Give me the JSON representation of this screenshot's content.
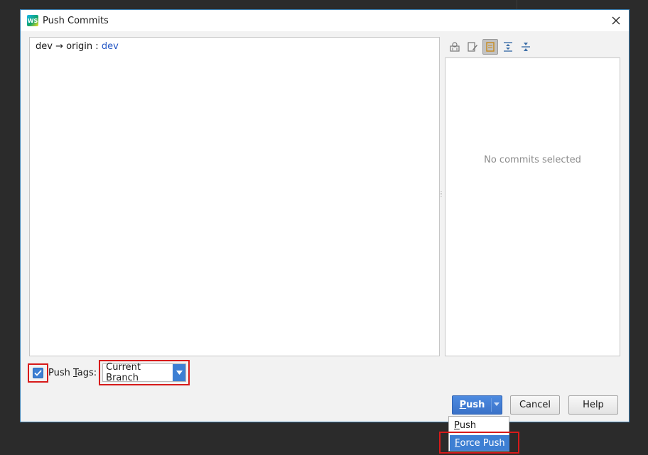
{
  "window": {
    "title": "Push Commits",
    "logo_text": "WS",
    "icon": "webstorm-logo-icon"
  },
  "left_panel": {
    "branch": {
      "source": "dev",
      "arrow": "→",
      "remote": "origin",
      "separator": ":",
      "target": "dev"
    }
  },
  "right_panel": {
    "toolbar_icons": [
      "author-icon",
      "edit-icon",
      "show-details-icon",
      "expand-all-icon",
      "collapse-all-icon"
    ],
    "empty_message": "No commits selected"
  },
  "push_tags": {
    "checked": true,
    "label_prefix": "Push ",
    "label_mnemonic": "T",
    "label_suffix": "ags:",
    "selected_option": "Current Branch"
  },
  "buttons": {
    "push": {
      "mnemonic": "P",
      "rest": "ush"
    },
    "cancel": "Cancel",
    "help": "Help"
  },
  "push_menu": {
    "push": {
      "mnemonic": "P",
      "rest": "ush"
    },
    "force_push": {
      "mnemonic": "F",
      "rest": "orce Push"
    }
  },
  "colors": {
    "accent": "#3d7fd3",
    "highlight_outline": "#d71a1a",
    "branch_target": "#2457c5"
  }
}
